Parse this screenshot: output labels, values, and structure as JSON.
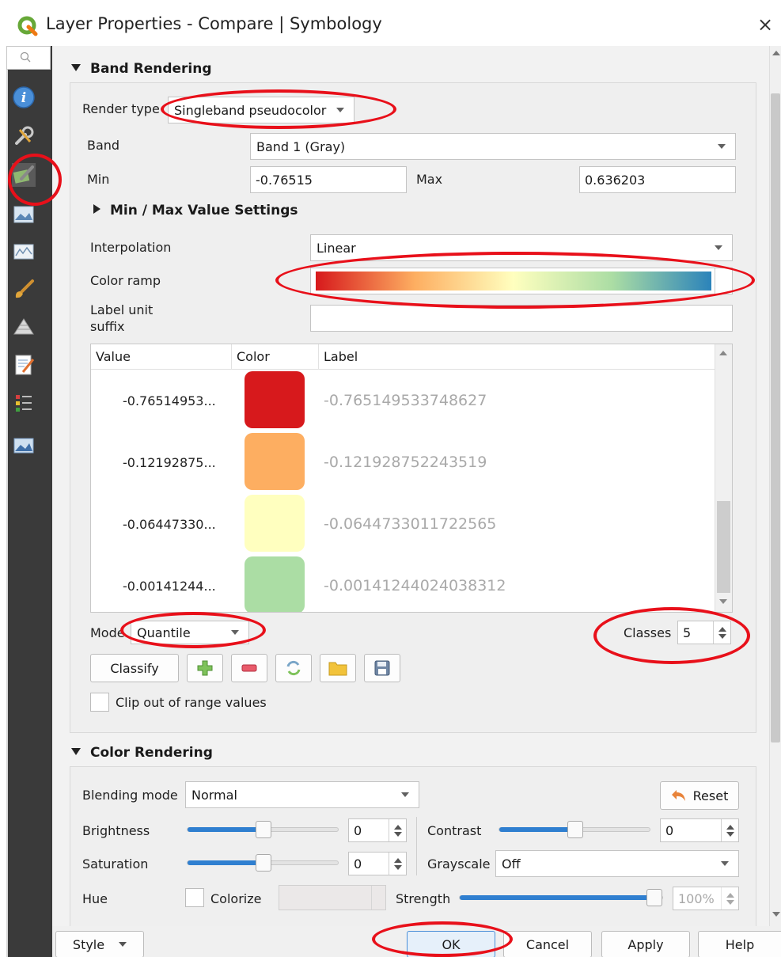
{
  "window": {
    "title": "Layer Properties - Compare | Symbology",
    "close_glyph": "×"
  },
  "sidebar": {
    "items": [
      {
        "name": "information",
        "icon": "info-icon"
      },
      {
        "name": "source",
        "icon": "wrench-icon"
      },
      {
        "name": "symbology",
        "icon": "brush-icon",
        "selected": true
      },
      {
        "name": "transparency",
        "icon": "image-icon"
      },
      {
        "name": "histogram",
        "icon": "histogram-icon"
      },
      {
        "name": "rendering",
        "icon": "paintbrush-icon"
      },
      {
        "name": "pyramids",
        "icon": "pyramid-icon"
      },
      {
        "name": "metadata",
        "icon": "notepad-icon"
      },
      {
        "name": "legend",
        "icon": "legend-icon"
      },
      {
        "name": "qgis-server",
        "icon": "server-icon"
      }
    ]
  },
  "band_rendering": {
    "header": "Band Rendering",
    "render_type_label": "Render type",
    "render_type_value": "Singleband pseudocolor",
    "band_label": "Band",
    "band_value": "Band 1 (Gray)",
    "min_label": "Min",
    "min_value": "-0.76515",
    "max_label": "Max",
    "max_value": "0.636203",
    "minmax_settings_label": "Min / Max Value Settings",
    "interpolation_label": "Interpolation",
    "interpolation_value": "Linear",
    "color_ramp_label": "Color ramp",
    "color_ramp_colors": [
      "#d7191c",
      "#fdae61",
      "#ffffbf",
      "#abdda4",
      "#2b83ba"
    ],
    "label_unit_suffix_label_1": "Label unit",
    "label_unit_suffix_label_2": "suffix",
    "label_unit_suffix_value": "",
    "table": {
      "headers": [
        "Value",
        "Color",
        "Label"
      ],
      "rows": [
        {
          "value": "-0.76514953...",
          "color": "#d7191c",
          "label": "-0.765149533748627"
        },
        {
          "value": "-0.12192875...",
          "color": "#fdae61",
          "label": "-0.121928752243519"
        },
        {
          "value": "-0.06447330...",
          "color": "#ffffbf",
          "label": "-0.0644733011722565"
        },
        {
          "value": "-0.00141244...",
          "color": "#abdda4",
          "label": "-0.00141244024038312"
        }
      ]
    },
    "mode_label": "Mode",
    "mode_value": "Quantile",
    "classes_label": "Classes",
    "classes_value": "5",
    "classify_label": "Classify",
    "clip_label": "Clip out of range values"
  },
  "color_rendering": {
    "header": "Color Rendering",
    "blending_mode_label": "Blending mode",
    "blending_mode_value": "Normal",
    "reset_label": "Reset",
    "brightness_label": "Brightness",
    "brightness_value": "0",
    "contrast_label": "Contrast",
    "contrast_value": "0",
    "saturation_label": "Saturation",
    "saturation_value": "0",
    "grayscale_label": "Grayscale",
    "grayscale_value": "Off",
    "hue_label": "Hue",
    "colorize_label": "Colorize",
    "strength_label": "Strength",
    "strength_value": "100%"
  },
  "buttons": {
    "style": "Style",
    "ok": "OK",
    "cancel": "Cancel",
    "apply": "Apply",
    "help": "Help"
  },
  "colors": {
    "annotation_red": "#e8101a",
    "slider_blue": "#2f7fd0",
    "sidebar_bg": "#3a3a3a"
  }
}
